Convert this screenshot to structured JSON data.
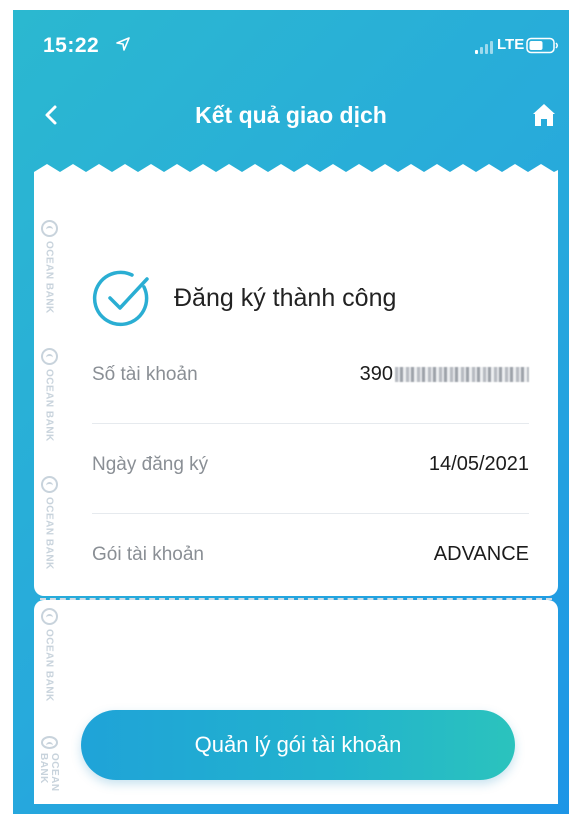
{
  "status_bar": {
    "time": "15:22",
    "network": "LTE"
  },
  "nav": {
    "title": "Kết quả giao dịch"
  },
  "watermark_text": "OCEAN BANK",
  "result": {
    "message": "Đăng ký thành công"
  },
  "details": [
    {
      "label": "Số tài khoản",
      "value": "390"
    },
    {
      "label": "Ngày đăng ký",
      "value": "14/05/2021"
    },
    {
      "label": "Gói tài khoản",
      "value": "ADVANCE"
    }
  ],
  "actions": {
    "manage_label": "Quản lý gói tài khoản"
  },
  "colors": {
    "accent": "#27a9dc",
    "accent_light": "#2bc3bd",
    "text_primary": "#1c1c1c",
    "text_secondary": "#8a8f95",
    "watermark": "#c8d3dc"
  },
  "icons": {
    "back": "chevron-left-icon",
    "home": "home-icon",
    "success": "check-circle-icon"
  }
}
